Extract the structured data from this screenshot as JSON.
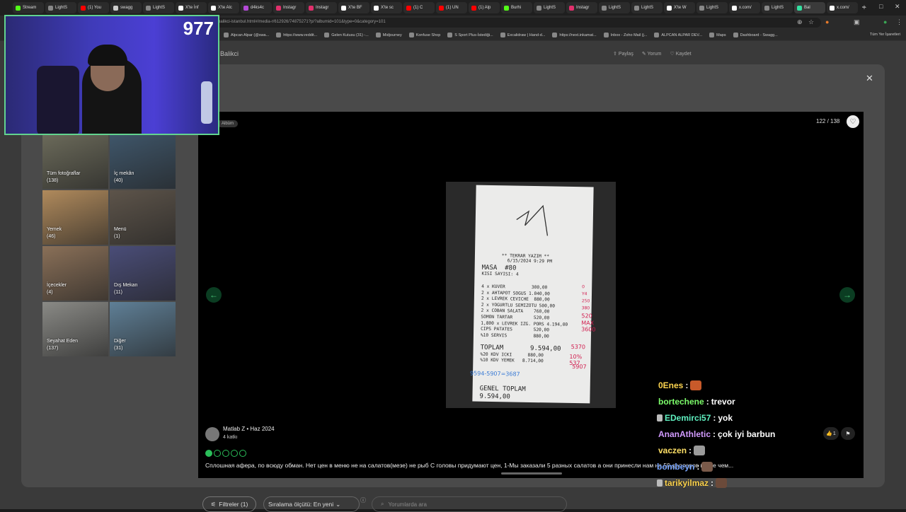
{
  "browser": {
    "tabs": [
      {
        "label": "Stream",
        "color": "#53fc18"
      },
      {
        "label": "LightS",
        "color": "#888888"
      },
      {
        "label": "(1) You",
        "color": "#ff0000"
      },
      {
        "label": "swagg",
        "color": "#cccccc"
      },
      {
        "label": "LightS",
        "color": "#888888"
      },
      {
        "label": "X'te İnf",
        "color": "#ffffff"
      },
      {
        "label": "X'te Alc",
        "color": "#ffffff"
      },
      {
        "label": "d4ks4c",
        "color": "#b44ad8"
      },
      {
        "label": "Instagr",
        "color": "#e1306c"
      },
      {
        "label": "Instagr",
        "color": "#e1306c"
      },
      {
        "label": "X'te BF",
        "color": "#ffffff"
      },
      {
        "label": "X'te sc",
        "color": "#ffffff"
      },
      {
        "label": "(1) C",
        "color": "#ff0000"
      },
      {
        "label": "(1) UN",
        "color": "#ff0000"
      },
      {
        "label": "(1) Alp",
        "color": "#ff0000"
      },
      {
        "label": "Burhi",
        "color": "#53fc18"
      },
      {
        "label": "LightS",
        "color": "#888888"
      },
      {
        "label": "Instagr",
        "color": "#e1306c"
      },
      {
        "label": "LightS",
        "color": "#888888"
      },
      {
        "label": "LightS",
        "color": "#888888"
      },
      {
        "label": "X'te W",
        "color": "#ffffff"
      },
      {
        "label": "LightS",
        "color": "#888888"
      },
      {
        "label": "x.com/",
        "color": "#ffffff"
      },
      {
        "label": "LightS",
        "color": "#888888"
      },
      {
        "label": "Bal",
        "color": "#34e0a1"
      },
      {
        "label": "x.com/",
        "color": "#ffffff"
      }
    ],
    "new_tab": "+",
    "url": "balikci-istanbul.html#/media-r/612926/74875271?p/?albumid=101&type=0&category=101",
    "bookmarks": [
      "Alpcan Alpar (@swa...",
      "https://www.reddit...",
      "Gelen Kutusu (31) -...",
      "Midjourney",
      "Konfuse Shop",
      "S Sport Plus-İstediği...",
      "Excalidraw | Hand-d...",
      "https://next.inkamat...",
      "Inbox - Zoho Mail (j...",
      "ALPCAN ALPAR DEV...",
      "Maps",
      "Dashboard - Swagg..."
    ],
    "all_bookmarks": "Tüm Yer İşaretleri"
  },
  "page": {
    "title": "k Balikci",
    "share": "Paylaş",
    "comment": "Yorum",
    "save": "Kaydet"
  },
  "albums": [
    {
      "label": "Tüm fotoğraflar",
      "count": "(138)",
      "color": "#6b6a5a"
    },
    {
      "label": "İç mekân",
      "count": "(40)",
      "color": "#3f566a"
    },
    {
      "label": "Yemek",
      "count": "(46)",
      "color": "#b08a5c"
    },
    {
      "label": "Menü",
      "count": "(1)",
      "color": "#5d544a"
    },
    {
      "label": "İçecekler",
      "count": "(4)",
      "color": "#8a7058"
    },
    {
      "label": "Dış Mekan",
      "count": "(11)",
      "color": "#4a4d78"
    },
    {
      "label": "Seyahat Eden",
      "count": "(137)",
      "color": "#8a8a86"
    },
    {
      "label": "Diğer",
      "count": "(31)",
      "color": "#5f7f96"
    }
  ],
  "viewer": {
    "album_tag": "Albüm",
    "counter": "122 / 138",
    "prev": "←",
    "next": "→",
    "receipt": {
      "header": "** TEKRAR YAZIM **",
      "datetime": "6/15/2024 9:29 PM",
      "table": "MASA  #80",
      "guests": "KISI SAYISI: 4",
      "items": [
        "4 x KUVER          300,00",
        "2 x AHTAPOT SOGUS 1.040,00",
        "2 x LEVREK CEVICHE  880,00",
        "2 x YOGURTLU SEMIZOTU 500,00",
        "2 x COBAN SALATA    760,00",
        "SOMON TARTAR        520,00",
        "1,800 x LEVREK IZG. PORS 4.194,00",
        "CIPS PATATES        520,00",
        "%10 SERVIS          880,00"
      ],
      "total": "TOPLAM       9.594,00",
      "tax1": "%20 KDV ICKI      880,00",
      "tax2": "%10 KDV YEMEK   8.714,00",
      "grand_label": "GENEL TOPLAM",
      "grand_value": "9.594,00",
      "hand_red": [
        "0",
        "Y4",
        "250",
        "380",
        "520",
        "MAX 3600",
        "5370",
        "10% 537",
        "5907"
      ],
      "hand_blue": "9594-5907=3687"
    }
  },
  "review": {
    "reviewer": "Matlab Z • Haz 2024",
    "contributions": "4 katkı",
    "rating": 1,
    "rating_max": 5,
    "text": "Сплошная афера, по всюду обман. Нет цен в меню не на салатов(мезе) не рыб С головы придумают цен, 1-Мы заказали 5 разных салатов а они принесли нам на 50 долларов выше чем...",
    "likes": "1"
  },
  "controls": {
    "filters": "Filtreler (1)",
    "sort": "Sıralama ölçütü: En yeni",
    "search_placeholder": "Yorumlarda ara"
  },
  "stream": {
    "viewers": "977"
  },
  "chat": [
    {
      "user": "0Enes",
      "color": "#ffd54f",
      "text": "",
      "emote": "#c85a2a"
    },
    {
      "user": "bortechene",
      "color": "#7dff6b",
      "text": "trevor",
      "emote": ""
    },
    {
      "user": "EDemirci57",
      "color": "#5ff0c0",
      "text": "yok",
      "emote": ""
    },
    {
      "user": "AnanAthletic",
      "color": "#d29bff",
      "text": "çok iyi barbun",
      "emote": ""
    },
    {
      "user": "vaczen",
      "color": "#ffe066",
      "text": "",
      "emote": "#9a9a9a"
    },
    {
      "user": "bombeyn",
      "color": "#7aa6ff",
      "text": "",
      "emote": "#7a5a4a"
    },
    {
      "user": "tarikyilmaz",
      "color": "#ffd54f",
      "text": "",
      "emote": "#6b4a3a"
    }
  ]
}
